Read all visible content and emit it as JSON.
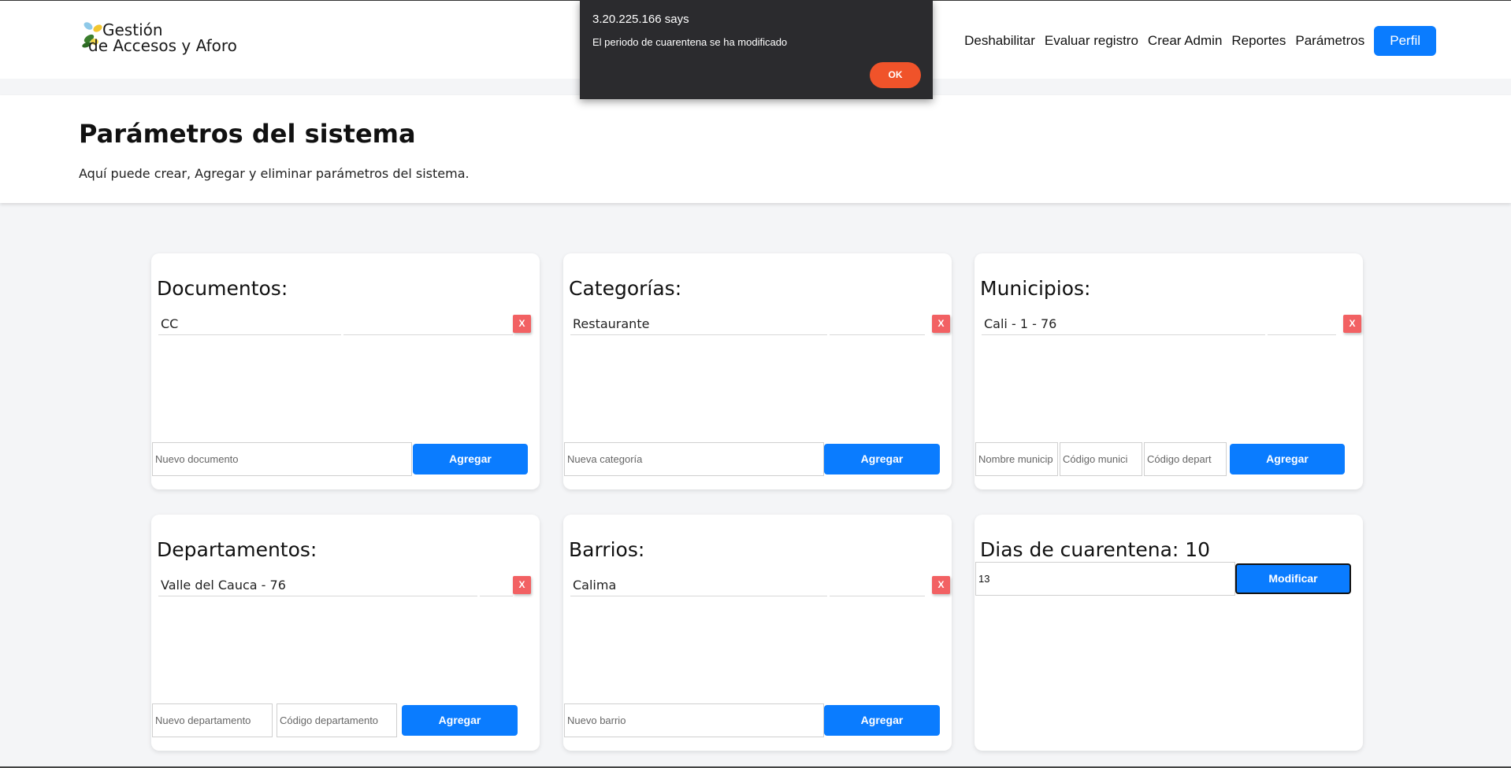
{
  "header": {
    "logo_line1": "Gestión",
    "logo_line2": "de Accesos y Aforo",
    "nav": [
      "Deshabilitar",
      "Evaluar registro",
      "Crear Admin",
      "Reportes",
      "Parámetros"
    ],
    "profile_label": "Perfil"
  },
  "page": {
    "title": "Parámetros del sistema",
    "description": "Aquí puede crear, Agregar y eliminar parámetros del sistema."
  },
  "cards": {
    "documentos": {
      "title": "Documentos:",
      "item": "CC",
      "delete_label": "X",
      "input_placeholder": "Nuevo documento",
      "add_label": "Agregar"
    },
    "categorias": {
      "title": "Categorías:",
      "item": "Restaurante",
      "delete_label": "X",
      "input_placeholder": "Nueva categoría",
      "add_label": "Agregar"
    },
    "municipios": {
      "title": "Municipios:",
      "item": "Cali - 1 - 76",
      "delete_label": "X",
      "placeholder_nombre": "Nombre municip",
      "placeholder_codigo": "Código munici",
      "placeholder_depart": "Código depart",
      "add_label": "Agregar"
    },
    "departamentos": {
      "title": "Departamentos:",
      "item": "Valle del Cauca - 76",
      "delete_label": "X",
      "placeholder_nombre": "Nuevo departamento",
      "placeholder_codigo": "Código departamento",
      "add_label": "Agregar"
    },
    "barrios": {
      "title": "Barrios:",
      "item": "Calima",
      "delete_label": "X",
      "input_placeholder": "Nuevo barrio",
      "add_label": "Agregar"
    },
    "cuarentena": {
      "title": "Dias de cuarentena: 10",
      "input_value": "13",
      "modify_label": "Modificar"
    }
  },
  "alert": {
    "origin": "3.20.225.166 says",
    "message": "El periodo de cuarentena se ha modificado",
    "ok_label": "OK"
  },
  "colors": {
    "primary": "#0a7cff",
    "delete": "#f26163",
    "alert_bg": "#2b2b2e",
    "alert_ok": "#f0532a"
  }
}
